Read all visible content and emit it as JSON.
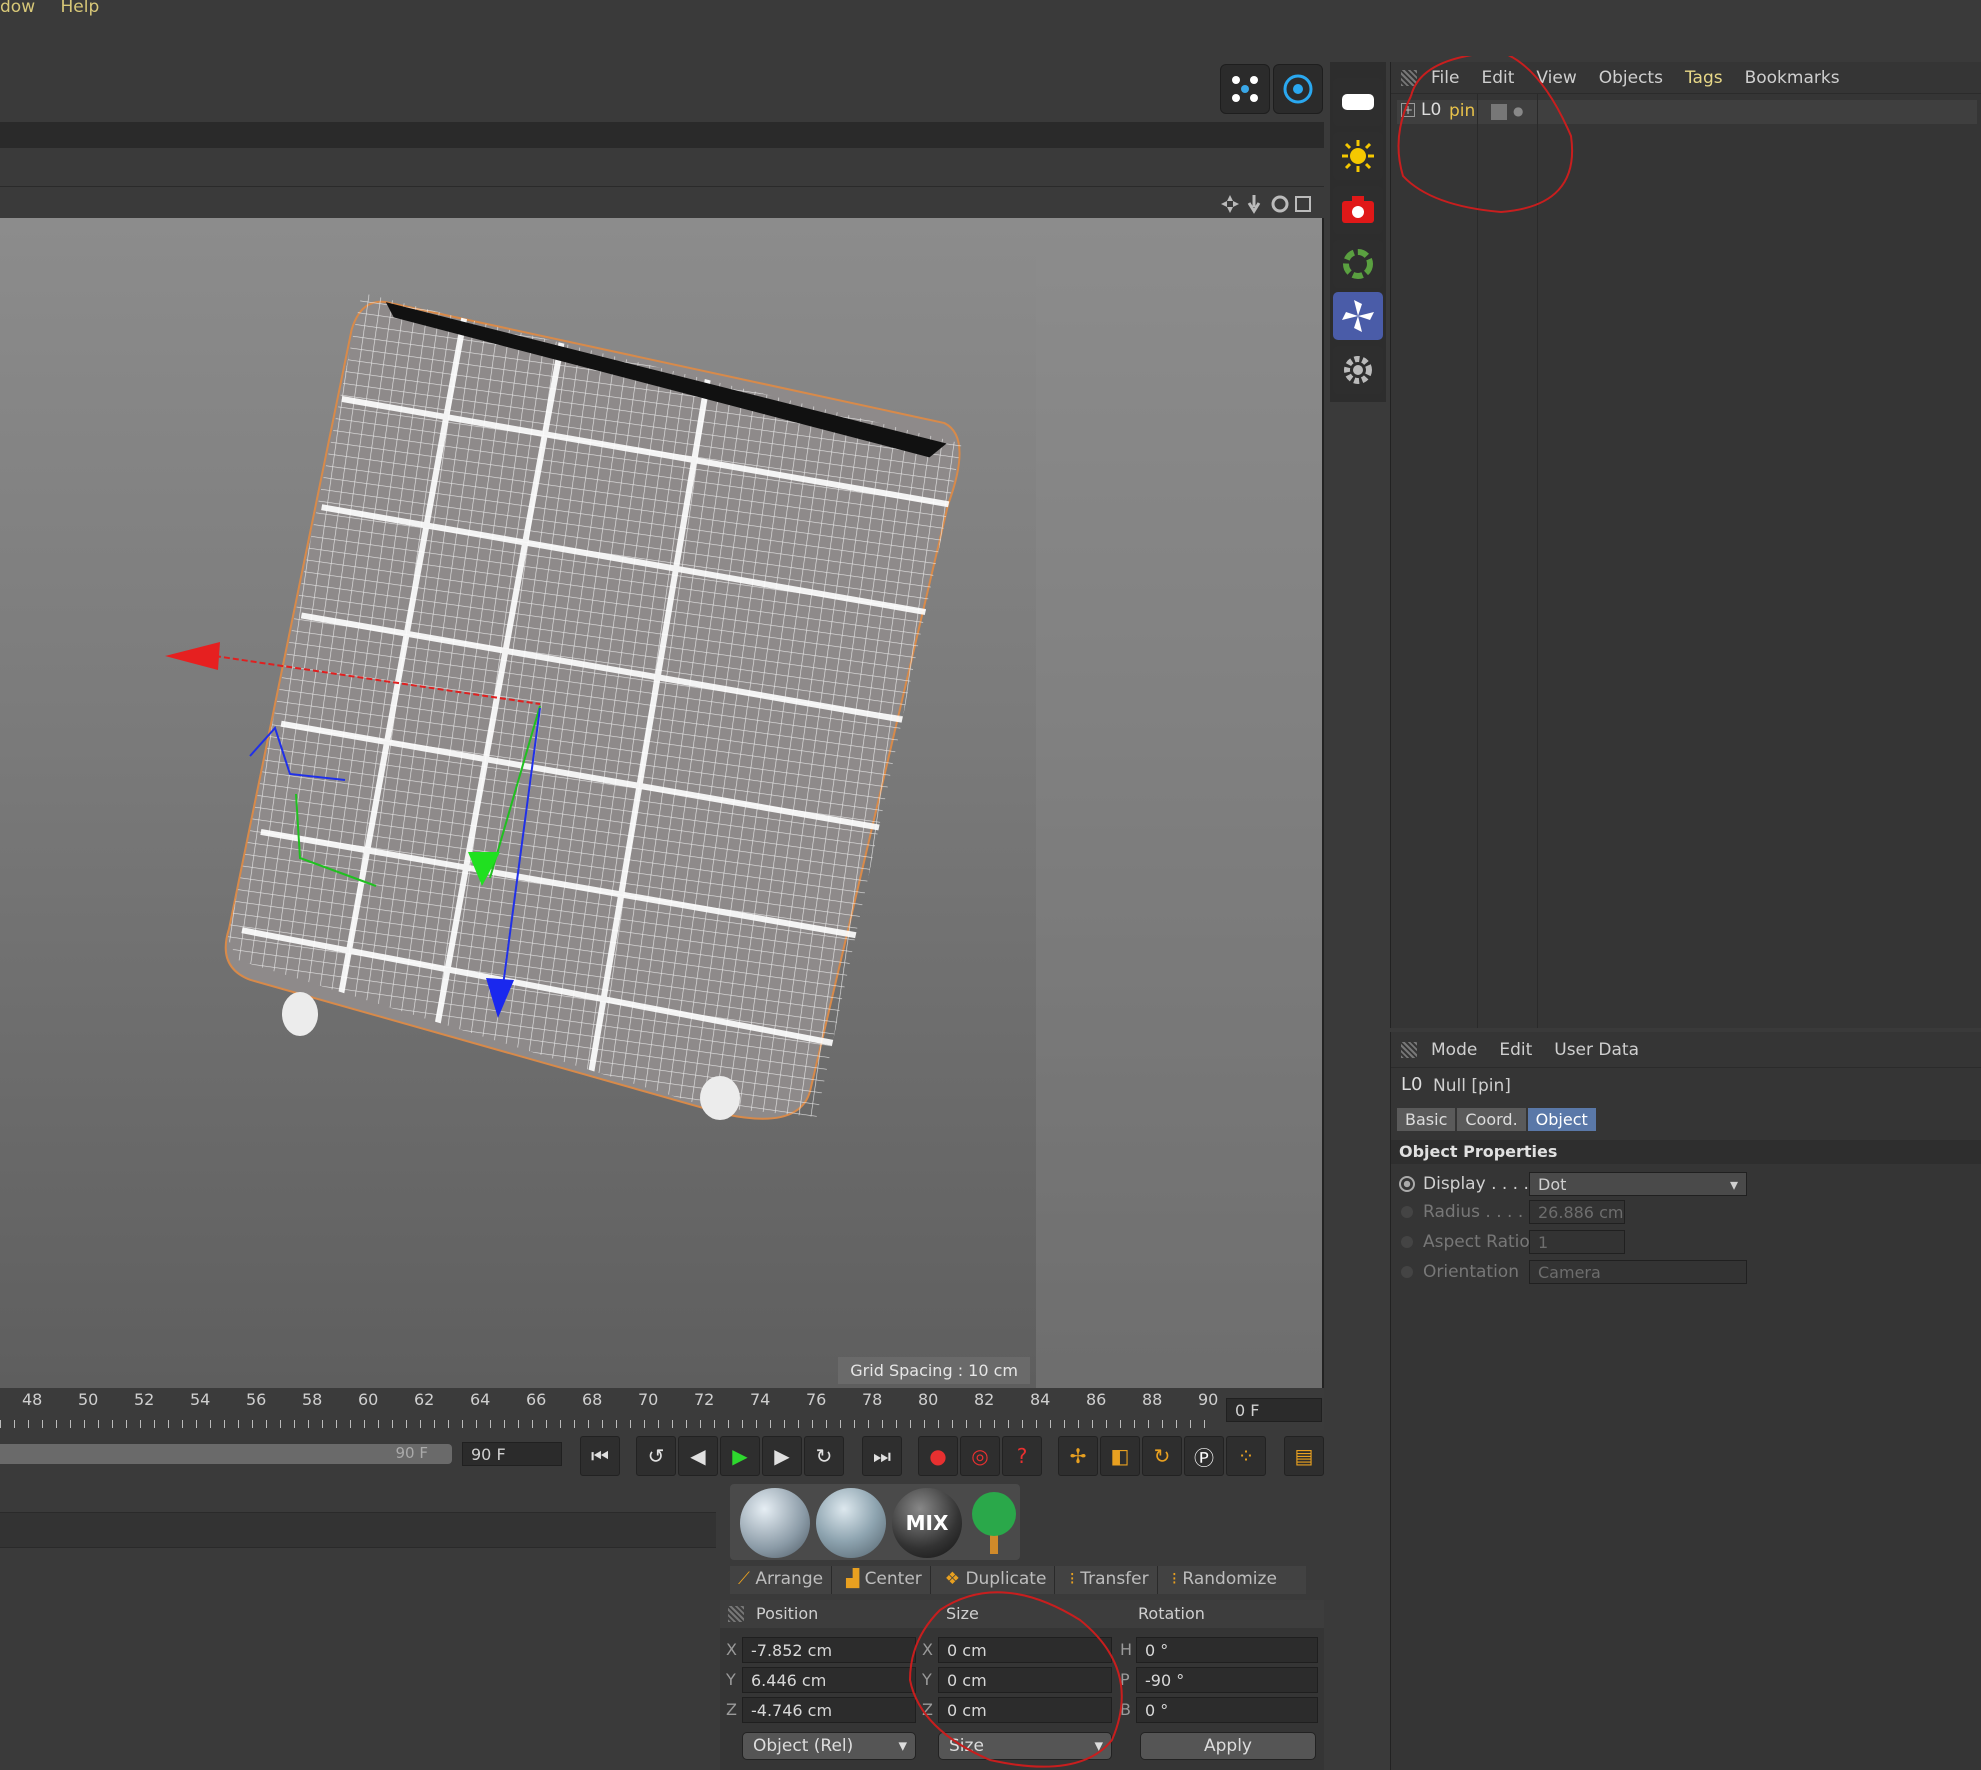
{
  "menubar": {
    "items": [
      "dow",
      "Help"
    ]
  },
  "object_manager": {
    "menu": [
      "File",
      "Edit",
      "View",
      "Objects",
      "Tags",
      "Bookmarks"
    ],
    "object_name": "pin"
  },
  "attribute_manager": {
    "menu": [
      "Mode",
      "Edit",
      "User Data"
    ],
    "title": "Null [pin]",
    "tabs": [
      "Basic",
      "Coord.",
      "Object"
    ],
    "active_tab": "Object",
    "section": "Object Properties",
    "rows": [
      {
        "label": "Display . . . . .",
        "value": "Dot"
      },
      {
        "label": "Radius . . . . .",
        "value": "26.886 cm"
      },
      {
        "label": "Aspect Ratio",
        "value": "1"
      },
      {
        "label": "Orientation",
        "value": "Camera"
      }
    ]
  },
  "viewport": {
    "grid_spacing": "Grid Spacing : 10 cm"
  },
  "timeline": {
    "ticks": [
      "48",
      "50",
      "52",
      "54",
      "56",
      "58",
      "60",
      "62",
      "64",
      "66",
      "68",
      "70",
      "72",
      "74",
      "76",
      "78",
      "80",
      "82",
      "84",
      "86",
      "88",
      "90"
    ],
    "current_frame": "0 F",
    "end_frame_slider": "90 F",
    "end_frame_field": "90 F"
  },
  "layout_tools": [
    "Arrange",
    "Center",
    "Duplicate",
    "Transfer",
    "Randomize"
  ],
  "coordinates": {
    "headers": [
      "Position",
      "Size",
      "Rotation"
    ],
    "position": [
      {
        "axis": "X",
        "value": "-7.852 cm"
      },
      {
        "axis": "Y",
        "value": "6.446 cm"
      },
      {
        "axis": "Z",
        "value": "-4.746 cm"
      }
    ],
    "size": [
      {
        "axis": "X",
        "value": "0 cm"
      },
      {
        "axis": "Y",
        "value": "0 cm"
      },
      {
        "axis": "Z",
        "value": "0 cm"
      }
    ],
    "rotation": [
      {
        "axis": "H",
        "value": "0 °"
      },
      {
        "axis": "P",
        "value": "-90 °"
      },
      {
        "axis": "B",
        "value": "0 °"
      }
    ],
    "mode_dropdown": "Object (Rel)",
    "size_dropdown": "Size",
    "apply_label": "Apply"
  },
  "materials": [
    "sphere-material",
    "glass-material",
    "mix-material",
    "tree-material"
  ],
  "material_mix_label": "MIX",
  "colors": {
    "accent": "#5a78a8",
    "menu_text": "#d8c878",
    "annotation": "#c81e1e"
  }
}
